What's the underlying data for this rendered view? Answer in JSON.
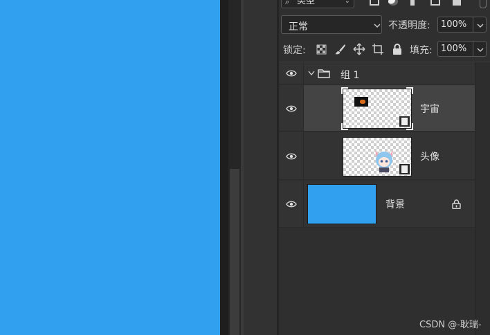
{
  "layers_panel": {
    "filter": {
      "value": "类型"
    },
    "blend_mode": {
      "value": "正常"
    },
    "opacity": {
      "label": "不透明度:",
      "value": "100%"
    },
    "lock": {
      "label": "锁定:"
    },
    "fill": {
      "label": "填充:",
      "value": "100%"
    },
    "layers": [
      {
        "name": "组 1",
        "type": "group"
      },
      {
        "name": "宇宙",
        "type": "smart-object",
        "selected": true
      },
      {
        "name": "头像",
        "type": "smart-object"
      },
      {
        "name": "背景",
        "type": "background",
        "locked": true
      }
    ]
  },
  "watermark": "CSDN @-耿瑞-",
  "colors": {
    "canvas": "#31a0ef",
    "panel": "#2f2f2f",
    "selected_row": "#444444"
  }
}
